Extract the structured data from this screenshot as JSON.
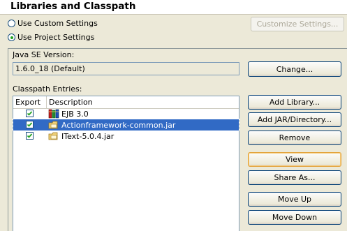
{
  "header": {
    "title": "Libraries and Classpath"
  },
  "settings": {
    "custom_label": "Use Custom Settings",
    "project_label": "Use Project Settings",
    "customize_button": "Customize Settings..."
  },
  "java_se": {
    "label": "Java SE Version:",
    "value": "1.6.0_18 (Default)",
    "change_button": "Change..."
  },
  "classpath": {
    "label": "Classpath Entries:",
    "columns": [
      "Export",
      "Description"
    ],
    "rows": [
      {
        "export": true,
        "description": "EJB 3.0",
        "icon": "library-icon",
        "selected": false
      },
      {
        "export": true,
        "description": "Actionframework-common.jar",
        "icon": "jar-icon",
        "selected": true
      },
      {
        "export": true,
        "description": "IText-5.0.4.jar",
        "icon": "jar-icon",
        "selected": false
      }
    ]
  },
  "buttons": {
    "add_library": "Add Library...",
    "add_jar": "Add JAR/Directory...",
    "remove": "Remove",
    "view": "View",
    "share_as": "Share As...",
    "move_up": "Move Up",
    "move_down": "Move Down"
  }
}
